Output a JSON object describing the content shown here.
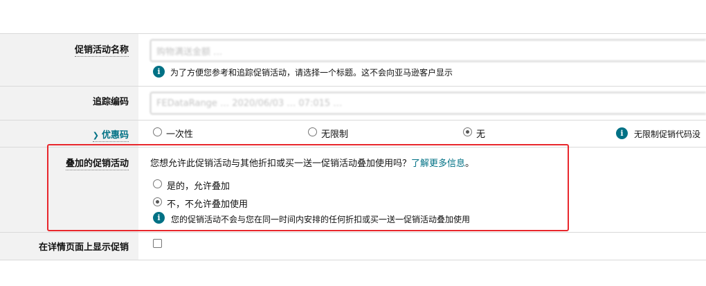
{
  "campaign_name": {
    "label": "促销活动名称",
    "value": "购物满送金额 …",
    "note": "为了方便您参考和追踪促销活动，请选择一个标题。这不会向亚马逊客户显示"
  },
  "tracking_code": {
    "label": "追踪编码",
    "value": "FEDataRange … 2020/06/03 … 07:015 …"
  },
  "coupon_code": {
    "label": "优惠码",
    "options": [
      "一次性",
      "无限制",
      "无"
    ],
    "selected": "无",
    "note": "无限制促销代码没"
  },
  "stacking": {
    "label": "叠加的促销活动",
    "question": "您想允许此促销活动与其他折扣或买一送一促销活动叠加使用吗？",
    "learn_more": "了解更多信息",
    "question_end": "。",
    "options": [
      "是的，允许叠加",
      "不，不允许叠加使用"
    ],
    "selected": "不，不允许叠加使用",
    "note": "您的促销活动不会与您在同一时间内安排的任何折扣或买一送一促销活动叠加使用",
    "highlight_color": "#e8262b"
  },
  "display_on_detail": {
    "label": "在详情页面上显示促销",
    "checked": false
  },
  "colors": {
    "accent": "#007185",
    "label_bg": "#f2f2f2"
  }
}
